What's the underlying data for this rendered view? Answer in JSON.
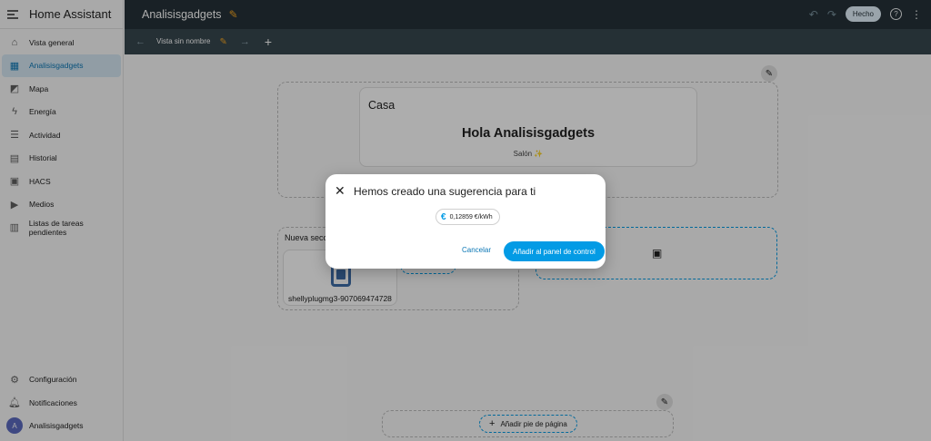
{
  "app": {
    "title": "Home Assistant"
  },
  "sidebar": {
    "items": [
      {
        "label": "Vista general",
        "icon": "home-icon"
      },
      {
        "label": "Analisisgadgets",
        "icon": "dashboard-icon",
        "active": true
      },
      {
        "label": "Mapa",
        "icon": "map-icon"
      },
      {
        "label": "Energía",
        "icon": "lightning-icon"
      },
      {
        "label": "Actividad",
        "icon": "list-icon"
      },
      {
        "label": "Historial",
        "icon": "chart-icon"
      },
      {
        "label": "HACS",
        "icon": "hacs-icon"
      },
      {
        "label": "Medios",
        "icon": "play-icon"
      },
      {
        "label": "Listas de tareas pendientes",
        "icon": "clipboard-icon"
      }
    ],
    "bottom": [
      {
        "label": "Configuración",
        "icon": "gear-icon"
      },
      {
        "label": "Notificaciones",
        "icon": "bell-icon"
      },
      {
        "label": "Analisisgadgets",
        "icon": "avatar",
        "initial": "A"
      }
    ]
  },
  "topbar": {
    "dashboard_title": "Analisisgadgets",
    "done_label": "Hecho"
  },
  "tabs": {
    "view_label": "Vista sin nombre"
  },
  "main": {
    "heading_card": {
      "title": "Casa",
      "greeting": "Hola Analisisgadgets",
      "subtitle": "Salón ✨"
    },
    "section": {
      "title": "Nueva sección",
      "device_name": "shellyplugmg3-907069474728"
    },
    "footer_button": "Añadir pie de página"
  },
  "dialog": {
    "title": "Hemos creado una sugerencia para ti",
    "chip_value": "0,12859 €/kWh",
    "cancel_label": "Cancelar",
    "confirm_label": "Añadir al panel de control"
  },
  "colors": {
    "primary": "#039be5",
    "topbar": "#263238",
    "tabbar": "#37474f",
    "accent_pencil": "#f5a623"
  }
}
